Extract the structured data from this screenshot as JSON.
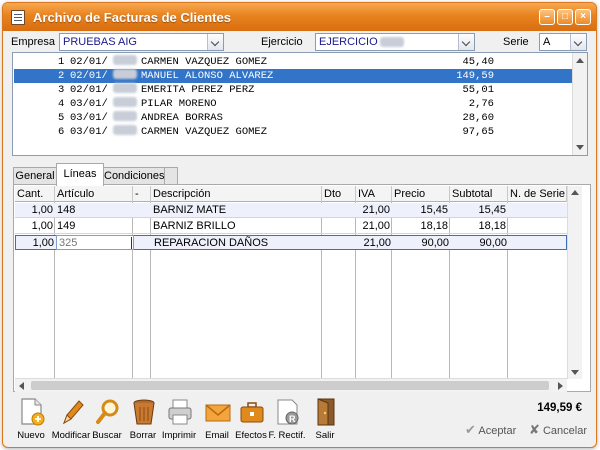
{
  "window": {
    "title": "Archivo de Facturas de Clientes"
  },
  "header": {
    "empresa_label": "Empresa",
    "empresa_value": "PRUEBAS AIG",
    "ejercicio_label": "Ejercicio",
    "ejercicio_value": "EJERCICIO",
    "serie_label": "Serie",
    "serie_value": "A"
  },
  "invoices": [
    {
      "num": "1",
      "date": "02/01/",
      "client": "CARMEN VAZQUEZ GOMEZ",
      "amount": "45,40"
    },
    {
      "num": "2",
      "date": "02/01/",
      "client": "MANUEL ALONSO ALVAREZ",
      "amount": "149,59"
    },
    {
      "num": "3",
      "date": "02/01/",
      "client": "EMERITA PEREZ PERZ",
      "amount": "55,01"
    },
    {
      "num": "4",
      "date": "03/01/",
      "client": "PILAR MORENO",
      "amount": "2,76"
    },
    {
      "num": "5",
      "date": "03/01/",
      "client": "ANDREA BORRAS",
      "amount": "28,60"
    },
    {
      "num": "6",
      "date": "03/01/",
      "client": "CARMEN VAZQUEZ GOMEZ",
      "amount": "97,65"
    }
  ],
  "tabs": [
    "General",
    "Líneas",
    "Condiciones"
  ],
  "lines": {
    "columns": [
      "Cant.",
      "Artículo",
      "-",
      "Descripción",
      "Dto",
      "IVA",
      "Precio",
      "Subtotal",
      "N. de Serie"
    ],
    "rows": [
      {
        "cant": "1,00",
        "articulo": "148",
        "descripcion": "BARNIZ MATE",
        "dto": "",
        "iva": "21,00",
        "precio": "15,45",
        "subtotal": "15,45"
      },
      {
        "cant": "1,00",
        "articulo": "149",
        "descripcion": "BARNIZ BRILLO",
        "dto": "",
        "iva": "21,00",
        "precio": "18,18",
        "subtotal": "18,18"
      },
      {
        "cant": "1,00",
        "articulo": "325",
        "descripcion": "REPARACION DAÑOS",
        "dto": "",
        "iva": "21,00",
        "precio": "90,00",
        "subtotal": "90,00"
      }
    ]
  },
  "toolbar": {
    "nuevo": "Nuevo",
    "modificar": "Modificar",
    "buscar": "Buscar",
    "borrar": "Borrar",
    "imprimir": "Imprimir",
    "email": "Email",
    "efectos": "Efectos",
    "rectif": "F. Rectif.",
    "salir": "Salir"
  },
  "total": "149,59 €",
  "actions": {
    "aceptar": "Aceptar",
    "cancelar": "Cancelar"
  },
  "colors": {
    "title_orange": "#e8821f",
    "selection_blue": "#3174c8",
    "text_blue": "#1a1a8c"
  }
}
